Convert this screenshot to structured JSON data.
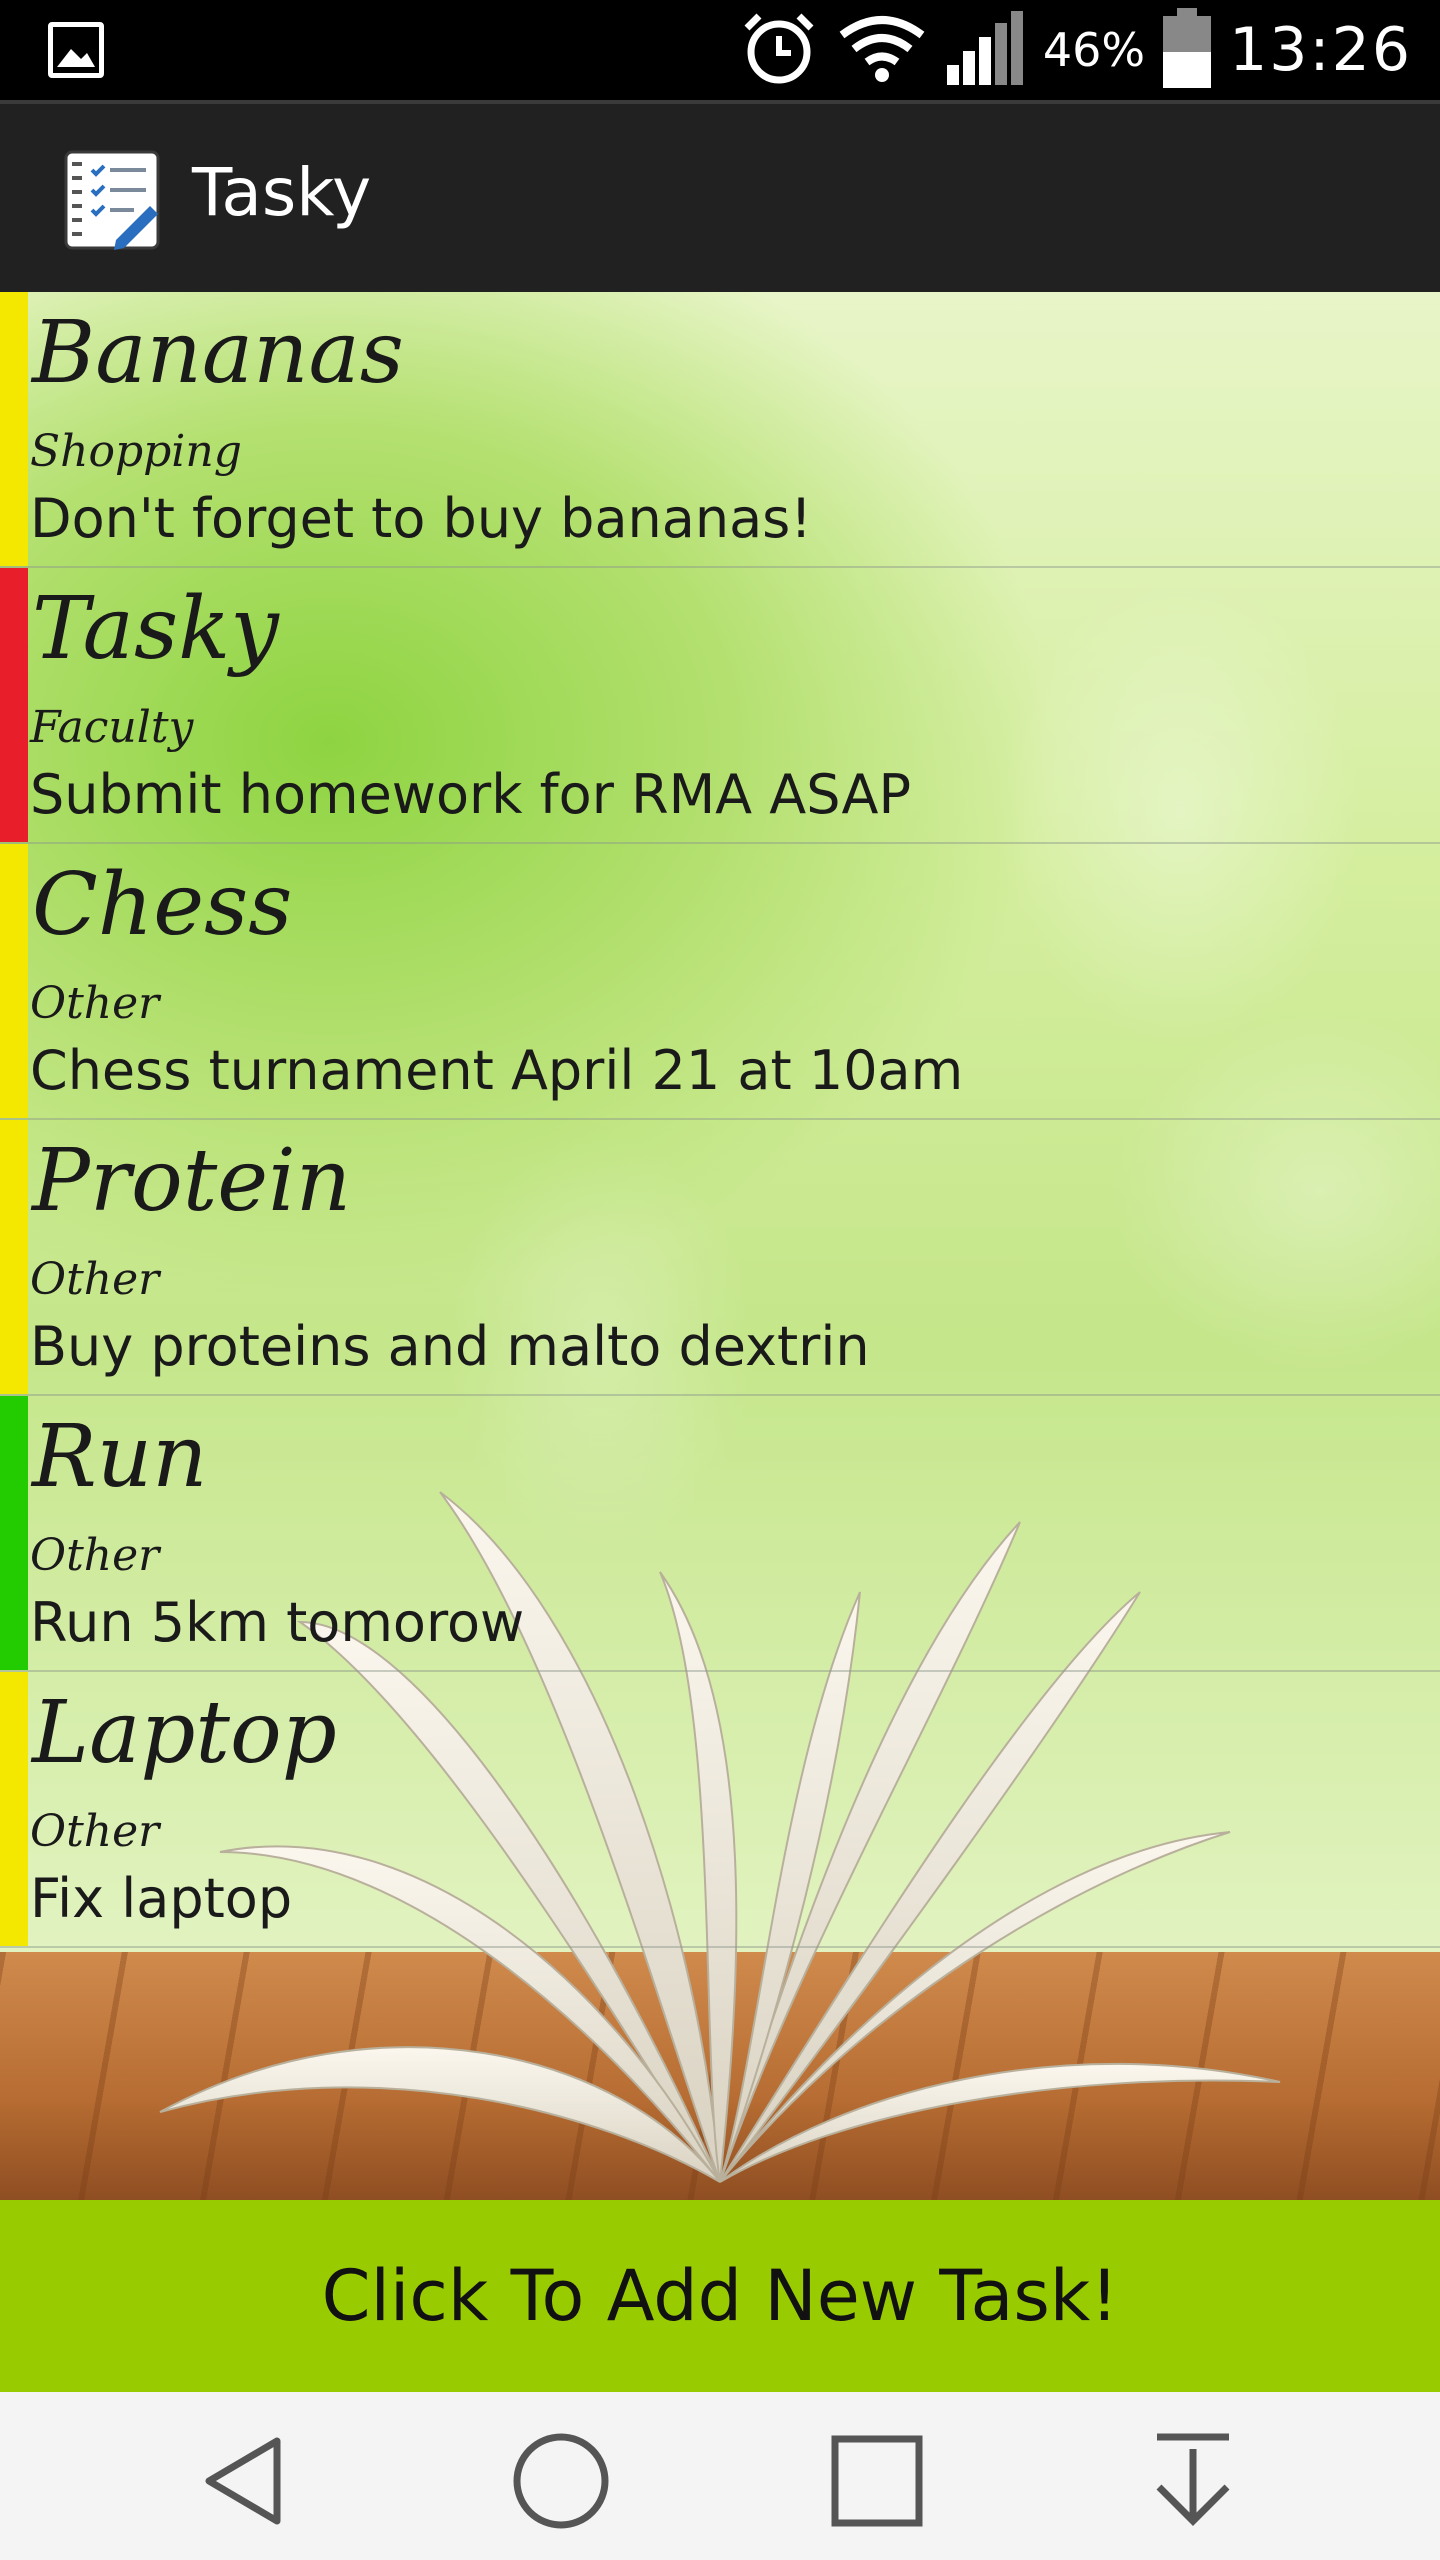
{
  "status_bar": {
    "battery_percent": "46%",
    "time": "13:26",
    "icons": [
      "gallery-icon",
      "alarm-icon",
      "wifi-icon",
      "signal-icon",
      "battery-icon"
    ]
  },
  "app_bar": {
    "title": "Tasky",
    "icon": "checklist-notebook-icon"
  },
  "tasks": [
    {
      "title": "Bananas",
      "category": "Shopping",
      "description": "Don't forget to buy bananas!",
      "priority_color": "#f5e800"
    },
    {
      "title": "Tasky",
      "category": "Faculty",
      "description": "Submit homework for RMA ASAP",
      "priority_color": "#e81e2a"
    },
    {
      "title": "Chess",
      "category": "Other",
      "description": "Chess turnament April 21 at 10am",
      "priority_color": "#f5e800"
    },
    {
      "title": "Protein",
      "category": "Other",
      "description": "Buy proteins and malto dextrin",
      "priority_color": "#f5e800"
    },
    {
      "title": "Run",
      "category": "Other",
      "description": "Run 5km tomorow",
      "priority_color": "#22cc00"
    },
    {
      "title": "Laptop",
      "category": "Other",
      "description": "Fix laptop",
      "priority_color": "#f5e800"
    }
  ],
  "add_button": {
    "label": "Click To Add New Task!",
    "color": "#99cc00"
  },
  "nav_bar": {
    "icons": [
      "back-icon",
      "home-icon",
      "recents-icon",
      "notification-pull-icon"
    ]
  }
}
